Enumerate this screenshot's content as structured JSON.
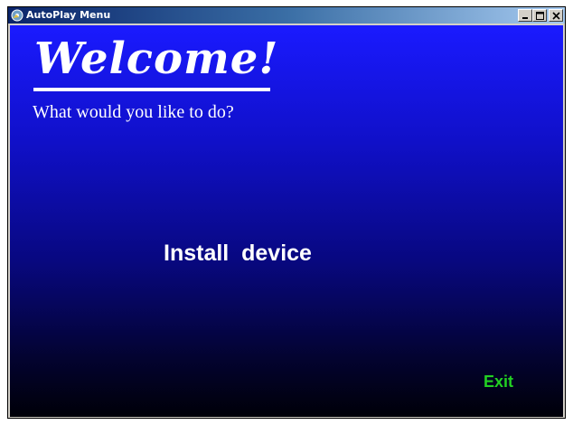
{
  "window": {
    "title": "AutoPlay Menu",
    "icon": "autoplay-app-icon",
    "controls": {
      "minimize": "minimize-icon",
      "maximize": "maximize-icon",
      "close": "close-icon"
    }
  },
  "main": {
    "heading": "Welcome!",
    "subtitle": "What would you like to do?",
    "install_label": "Install  device",
    "exit_label": "Exit"
  },
  "colors": {
    "background_top": "#1a1aff",
    "background_bottom": "#000008",
    "text": "#ffffff",
    "exit": "#22d022"
  }
}
